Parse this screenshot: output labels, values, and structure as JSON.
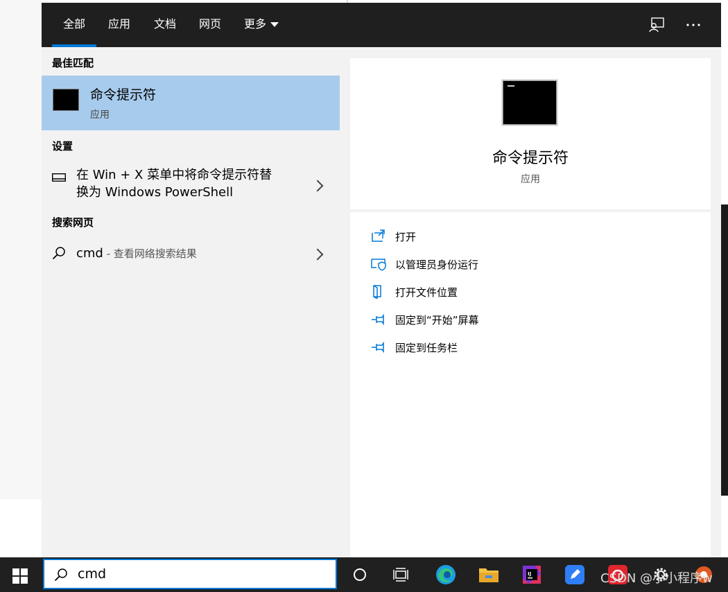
{
  "tabs": [
    {
      "label": "全部"
    },
    {
      "label": "应用"
    },
    {
      "label": "文档"
    },
    {
      "label": "网页"
    },
    {
      "label": "更多"
    }
  ],
  "sections": {
    "best_match": "最佳匹配",
    "settings": "设置",
    "web": "搜索网页"
  },
  "best_match": {
    "title": "命令提示符",
    "subtitle": "应用"
  },
  "settings_item": {
    "line1": "在 Win + X 菜单中将命令提示符替",
    "line2": "换为 Windows PowerShell"
  },
  "web_item": {
    "query": "cmd",
    "suffix": " - 查看网络搜索结果"
  },
  "preview": {
    "title": "命令提示符",
    "subtitle": "应用"
  },
  "actions": [
    {
      "label": "打开",
      "icon": "open-icon"
    },
    {
      "label": "以管理员身份运行",
      "icon": "shield-icon"
    },
    {
      "label": "打开文件位置",
      "icon": "file-location-icon"
    },
    {
      "label": "固定到“开始”屏幕",
      "icon": "pin-icon"
    },
    {
      "label": "固定到任务栏",
      "icon": "pin-icon"
    }
  ],
  "search": {
    "value": "cmd"
  },
  "watermark": "CSDN @小小程序w",
  "colors": {
    "accent": "#0078d7",
    "selected": "#a7cbec",
    "topbar": "#1f1f1f",
    "taskbar": "#202020"
  }
}
